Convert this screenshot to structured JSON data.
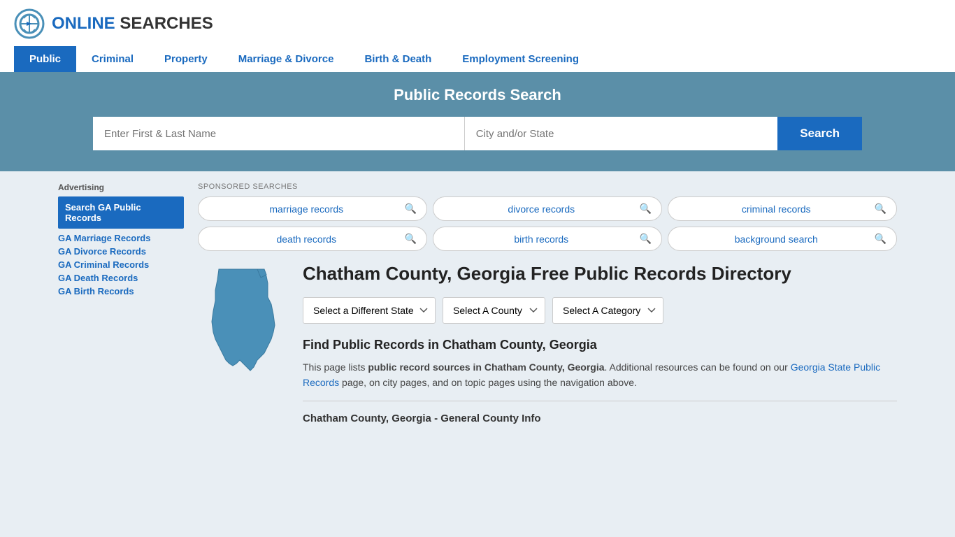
{
  "logo": {
    "text_online": "ONLINE",
    "text_searches": "SEARCHES"
  },
  "nav": {
    "items": [
      {
        "label": "Public",
        "active": true
      },
      {
        "label": "Criminal",
        "active": false
      },
      {
        "label": "Property",
        "active": false
      },
      {
        "label": "Marriage & Divorce",
        "active": false
      },
      {
        "label": "Birth & Death",
        "active": false
      },
      {
        "label": "Employment Screening",
        "active": false
      }
    ]
  },
  "hero": {
    "title": "Public Records Search",
    "name_placeholder": "Enter First & Last Name",
    "location_placeholder": "City and/or State",
    "search_button": "Search"
  },
  "sponsored": {
    "label": "SPONSORED SEARCHES",
    "items": [
      {
        "text": "marriage records"
      },
      {
        "text": "divorce records"
      },
      {
        "text": "criminal records"
      },
      {
        "text": "death records"
      },
      {
        "text": "birth records"
      },
      {
        "text": "background search"
      }
    ]
  },
  "directory": {
    "title": "Chatham County, Georgia Free Public Records Directory",
    "dropdowns": {
      "state": "Select a Different State",
      "county": "Select A County",
      "category": "Select A Category"
    },
    "find_title": "Find Public Records in Chatham County, Georgia",
    "find_description_1": "This page lists ",
    "find_description_bold": "public record sources in Chatham County, Georgia",
    "find_description_2": ". Additional resources can be found on our ",
    "find_link_text": "Georgia State Public Records",
    "find_description_3": " page, on city pages, and on topic pages using the navigation above.",
    "general_info_title": "Chatham County, Georgia - General County Info"
  },
  "sidebar": {
    "ad_label": "Advertising",
    "ad_item": "Search GA Public Records",
    "links": [
      {
        "text": "GA Marriage Records"
      },
      {
        "text": "GA Divorce Records"
      },
      {
        "text": "GA Criminal Records"
      },
      {
        "text": "GA Death Records"
      },
      {
        "text": "GA Birth Records"
      }
    ]
  }
}
